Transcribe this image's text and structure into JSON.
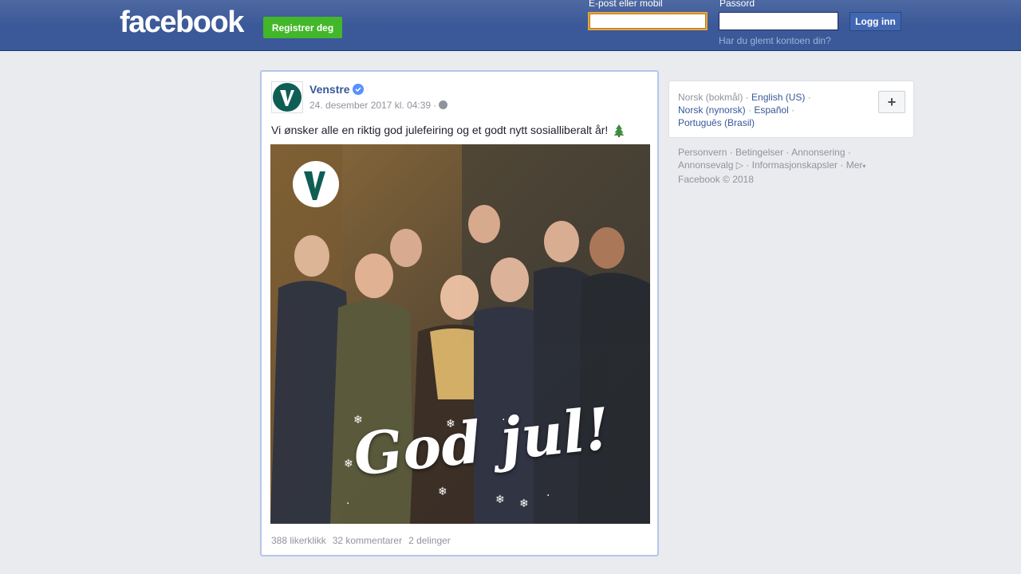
{
  "header": {
    "logo": "facebook",
    "signup_label": "Registrer deg",
    "email_label": "E-post eller mobil",
    "email_value": "",
    "password_label": "Passord",
    "password_value": "",
    "login_label": "Logg inn",
    "forgot_label": "Har du glemt kontoen din?"
  },
  "post": {
    "page_name": "Venstre",
    "timestamp": "24. desember 2017 kl. 04:39",
    "meta_sep": "·",
    "text": "Vi ønsker alle en riktig god julefeiring og et godt nytt sosialliberalt år!",
    "image_caption": "God jul!",
    "likes": "388 likerklikk",
    "comments": "32 kommentarer",
    "shares": "2 delinger"
  },
  "languages": {
    "current": "Norsk (bokmål)",
    "links": [
      "English (US)",
      "Norsk (nynorsk)",
      "Español",
      "Português (Brasil)"
    ],
    "more_label": "+"
  },
  "footer": {
    "links": [
      "Personvern",
      "Betingelser",
      "Annonsering",
      "Annonsevalg",
      "Informasjonskapsler",
      "Mer"
    ],
    "copyright": "Facebook © 2018"
  },
  "colors": {
    "brand_blue": "#3b5998",
    "link_blue": "#365899",
    "signup_green": "#42b72a",
    "venstre_green": "#0f5e55"
  }
}
